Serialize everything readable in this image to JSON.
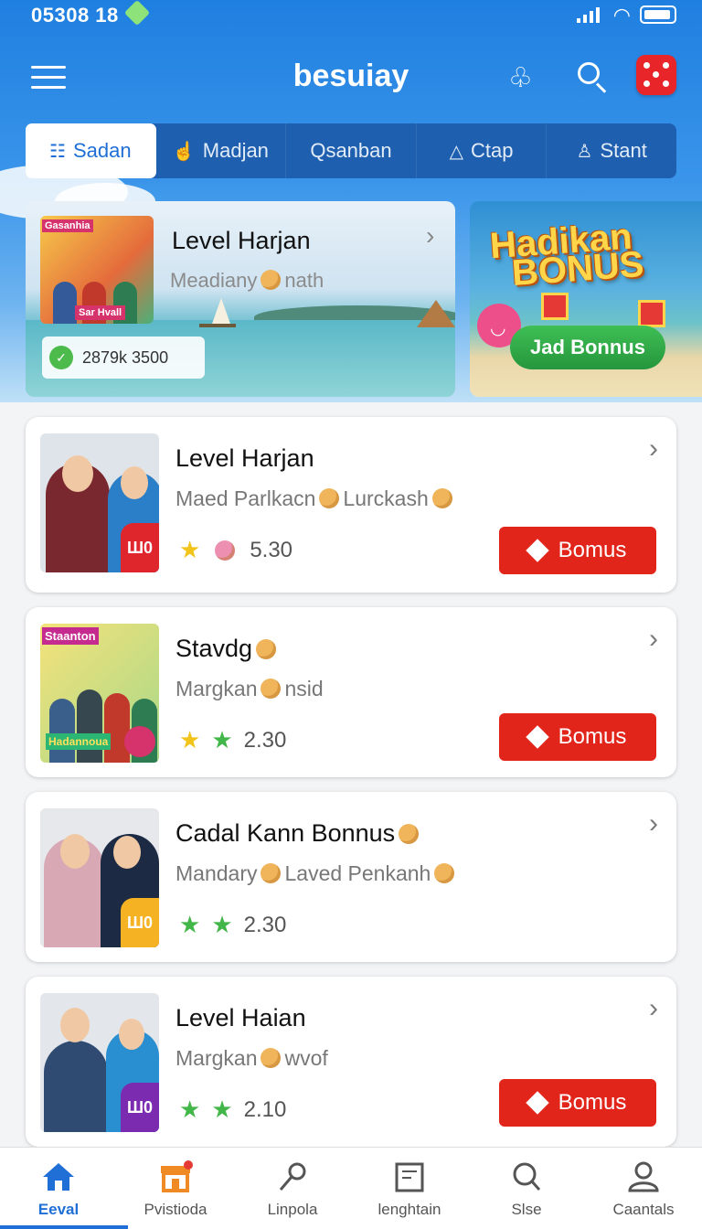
{
  "status": {
    "time": "05308 18"
  },
  "app": {
    "title": "besuiay"
  },
  "tabs": [
    {
      "label": "Sadan",
      "icon": "list-icon"
    },
    {
      "label": "Madjan",
      "icon": "hand-icon"
    },
    {
      "label": "Qsanban",
      "icon": "search-icon"
    },
    {
      "label": "Ctap",
      "icon": "warning-icon"
    },
    {
      "label": "Stant",
      "icon": "person-icon"
    }
  ],
  "hero": {
    "title": "Level Harjan",
    "subtitle_a": "Meadiany",
    "subtitle_b": "nath",
    "thumb_tag1": "Gasanhia",
    "thumb_tag2": "Sar Hvall",
    "pill_value": "2879k 3500"
  },
  "promo": {
    "title_line1": "Hadikan",
    "title_line2": "BONUS",
    "button_label": "Jad Bonnus"
  },
  "items": [
    {
      "title": "Level Harjan",
      "sub_a": "Maed Parlkacn",
      "sub_b": "Lurckash",
      "rating": "5.30",
      "badge": "Ш0",
      "has_bonus": true,
      "bonus_label": "Bomus"
    },
    {
      "title": "Stavdg",
      "sub_a": "Margkan",
      "sub_b": "nsid",
      "rating": "2.30",
      "badge": "",
      "has_bonus": true,
      "bonus_label": "Bomus",
      "thumb_tag1": "Staanton",
      "thumb_tag2": "Hadannoua"
    },
    {
      "title": "Cadal Kann Bonnus",
      "sub_a": "Mandary",
      "sub_b": "Laved Penkanh",
      "rating": "2.30",
      "badge": "Ш0",
      "has_bonus": false
    },
    {
      "title": "Level Haian",
      "sub_a": "Margkan",
      "sub_b": "wvof",
      "rating": "2.10",
      "badge": "Ш0",
      "has_bonus": true,
      "bonus_label": "Bomus"
    }
  ],
  "nav": [
    {
      "label": "Eeval",
      "icon": "home-icon",
      "active": true
    },
    {
      "label": "Pvistioda",
      "icon": "shop-icon",
      "active": false
    },
    {
      "label": "Linpola",
      "icon": "key-icon",
      "active": false
    },
    {
      "label": "lenghtain",
      "icon": "calendar-icon",
      "active": false
    },
    {
      "label": "Slse",
      "icon": "search-icon",
      "active": false
    },
    {
      "label": "Caantals",
      "icon": "profile-icon",
      "active": false
    }
  ],
  "colors": {
    "primary": "#1f6fd6",
    "header_blue": "#1f7fe0",
    "bonus_red": "#e1251b",
    "promo_green": "#25963c"
  }
}
